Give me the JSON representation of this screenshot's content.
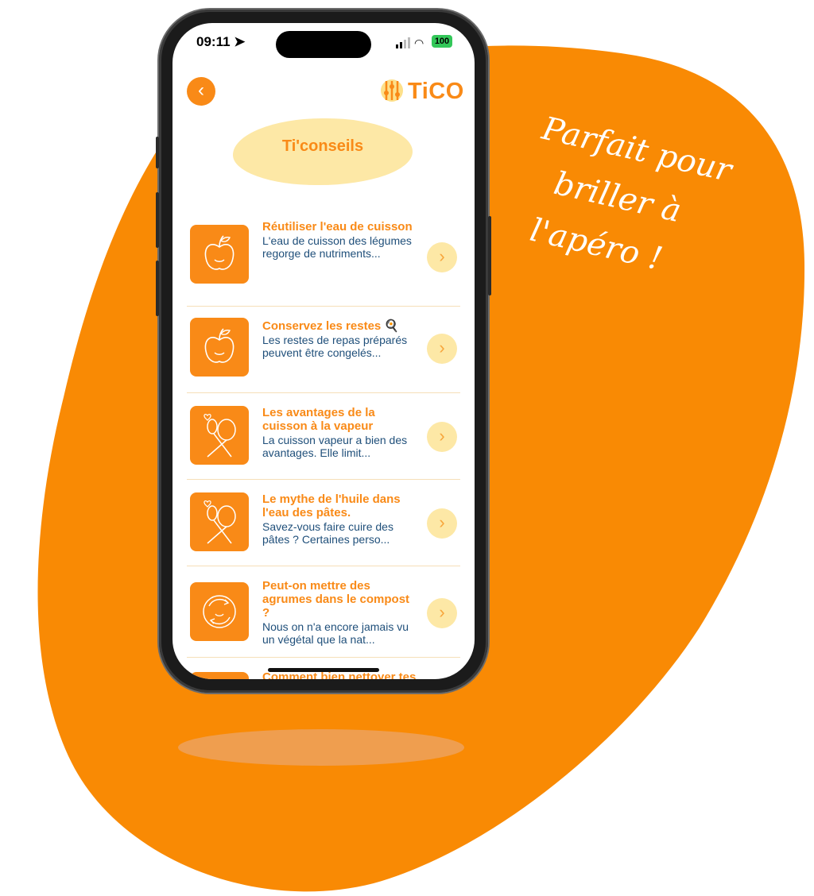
{
  "tagline": [
    "Parfait pour",
    "briller à",
    "l'apéro !"
  ],
  "status": {
    "time": "09:11",
    "battery": "100"
  },
  "header": {
    "back_icon": "chevron-left-icon",
    "logo_text": "TiCO"
  },
  "page_title": "Ti'conseils",
  "colors": {
    "accent": "#f98a17",
    "soft": "#fde8a6",
    "text_blue": "#1f4f7a"
  },
  "tips": [
    {
      "title": "Réutiliser l'eau de cuisson",
      "description": "L'eau de cuisson des légumes regorge de nutriments...",
      "icon": "apple-icon"
    },
    {
      "title": "Conservez les restes 🍳",
      "description": "Les restes de repas préparés peuvent être congelés...",
      "icon": "apple-icon"
    },
    {
      "title": "Les avantages de la cuisson à la vapeur",
      "description": "La cuisson vapeur a bien des avantages. Elle limit...",
      "icon": "utensils-icon"
    },
    {
      "title": "Le mythe de l'huile dans l'eau des pâtes.",
      "description": "Savez-vous faire cuire des pâtes ? Certaines perso...",
      "icon": "utensils-icon"
    },
    {
      "title": "Peut-on mettre des agrumes dans le compost ?",
      "description": "Nous on n'a encore jamais vu un végétal que la nat...",
      "icon": "recycle-icon"
    },
    {
      "title": "Comment bien nettoyer tes couteaux et planches",
      "description": "",
      "icon": "recycle-icon"
    }
  ]
}
